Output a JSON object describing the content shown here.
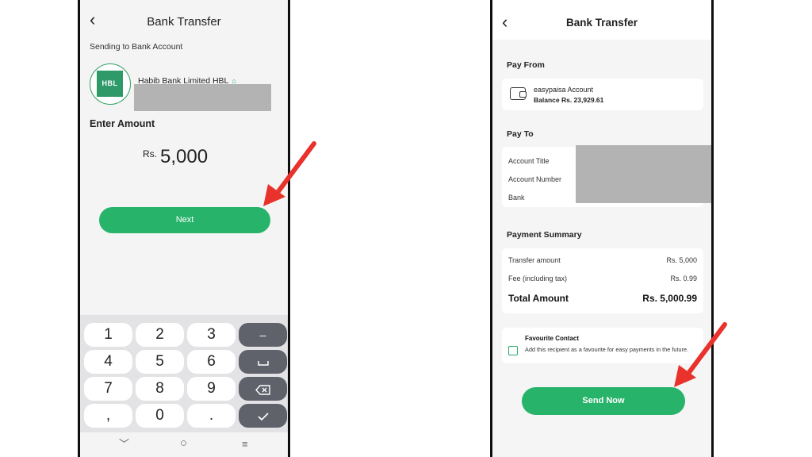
{
  "left_screen": {
    "title": "Bank Transfer",
    "back_icon": "back-chevron-icon",
    "sending_label": "Sending to Bank Account",
    "bank_logo_text": "HBL",
    "bank_name": "Habib Bank Limited HBL",
    "enter_amount_label": "Enter Amount",
    "currency": "Rs.",
    "amount": "5,000",
    "next_label": "Next",
    "keypad": {
      "keys": [
        "1",
        "2",
        "3",
        "4",
        "5",
        "6",
        "7",
        "8",
        "9",
        ",",
        "0",
        "."
      ],
      "minus_label": "–"
    },
    "nav": {
      "back": "﹀",
      "home": "○",
      "menu": "≡"
    }
  },
  "right_screen": {
    "title": "Bank Transfer",
    "pay_from_label": "Pay From",
    "account_name": "easypaisa Account",
    "balance": "Balance Rs. 23,929.61",
    "pay_to_label": "Pay To",
    "pay_to_rows": [
      "Account Title",
      "Account Number",
      "Bank"
    ],
    "summary_label": "Payment Summary",
    "transfer_amount_label": "Transfer amount",
    "transfer_amount_value": "Rs. 5,000",
    "fee_label": "Fee (including tax)",
    "fee_value": "Rs. 0.99",
    "total_label": "Total Amount",
    "total_value": "Rs. 5,000.99",
    "favourite_title": "Favourite Contact",
    "favourite_desc": "Add this recipient as a favourite for easy payments in the future.",
    "send_label": "Send Now"
  },
  "colors": {
    "accent": "#27b36a",
    "arrow": "#e8322b",
    "redacted": "#b3b3b3"
  }
}
